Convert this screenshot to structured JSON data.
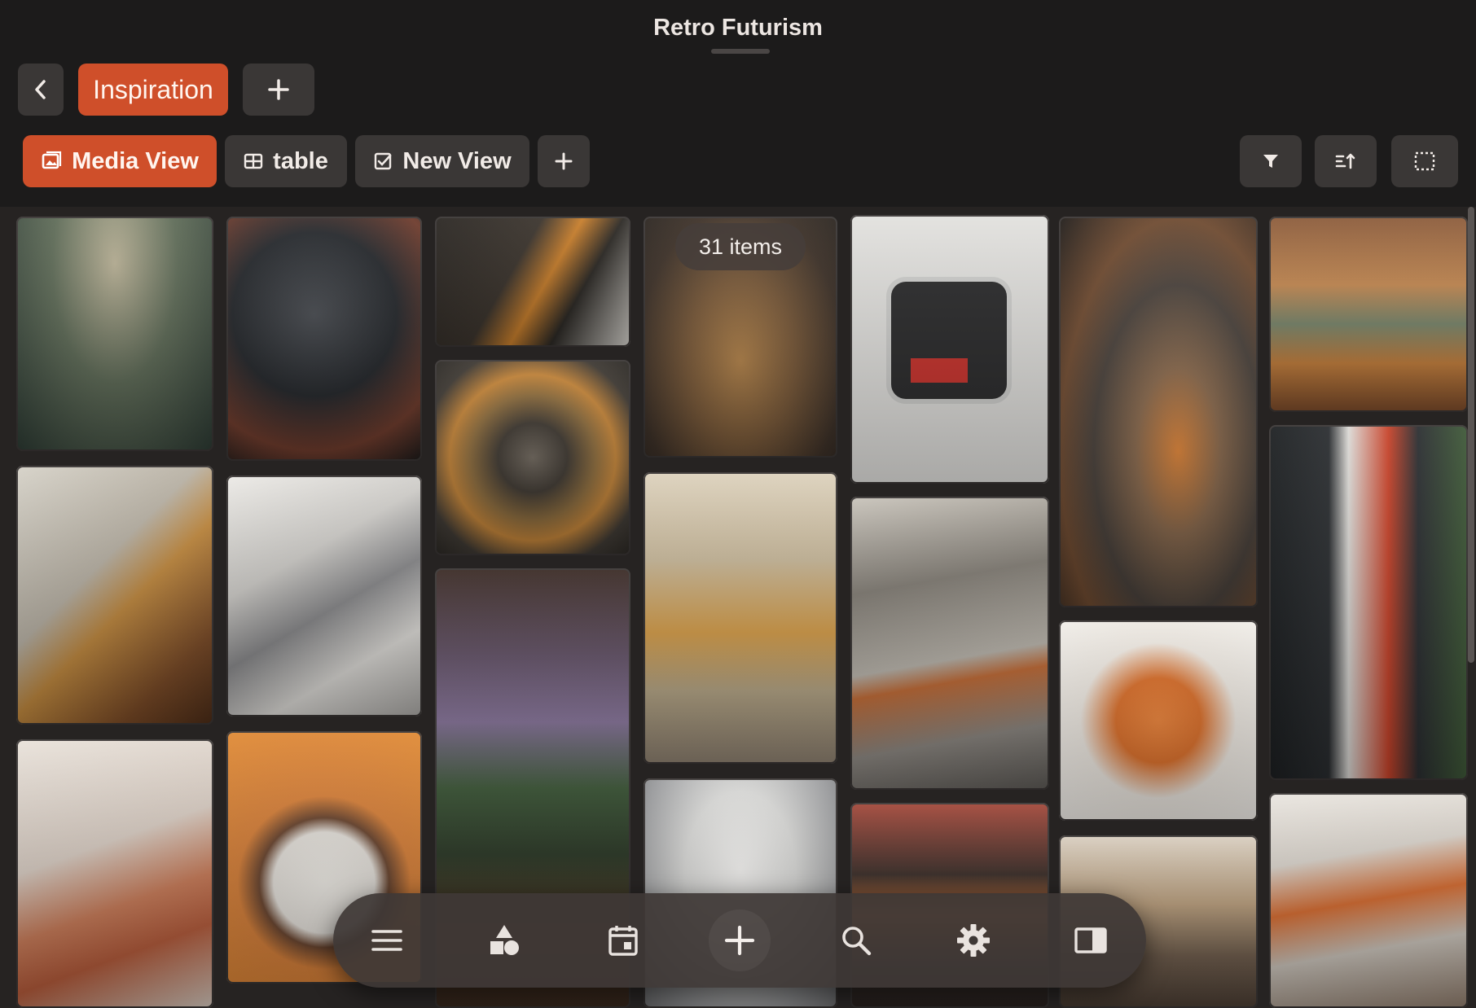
{
  "window": {
    "title": "Retro Futurism"
  },
  "nav": {
    "back_icon": "chevron-left-icon",
    "active_tab": "Inspiration",
    "add_icon": "plus-icon"
  },
  "views": {
    "items": [
      {
        "label": "Media View",
        "icon": "image-icon",
        "active": true
      },
      {
        "label": "table",
        "icon": "table-icon",
        "active": false
      },
      {
        "label": "New View",
        "icon": "checkbox-icon",
        "active": false
      }
    ],
    "add_icon": "plus-icon"
  },
  "toolbar": {
    "filter_icon": "filter-icon",
    "sort_icon": "sort-icon",
    "select_icon": "select-icon"
  },
  "gallery": {
    "count_label": "31 items",
    "accent": "#cf4f2a"
  },
  "dock": {
    "items": [
      "menu-icon",
      "shapes-icon",
      "calendar-icon",
      "plus-icon",
      "search-icon",
      "gear-icon",
      "sidebar-icon"
    ]
  }
}
